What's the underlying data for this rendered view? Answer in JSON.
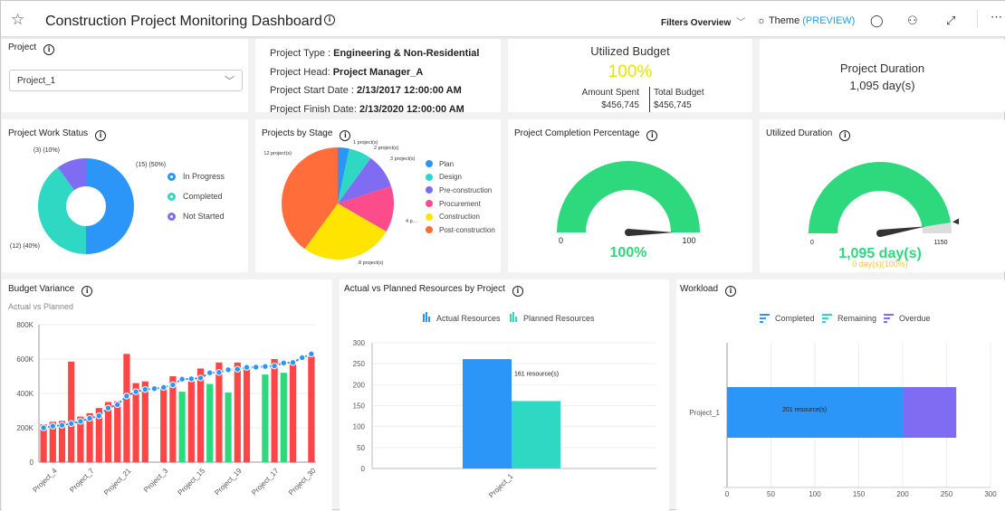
{
  "header": {
    "title": "Construction Project Monitoring Dashboard",
    "filters_label": "Filters Overview",
    "theme_label": "Theme",
    "theme_preview": "(PREVIEW)",
    "icons": [
      "star-icon",
      "info-icon",
      "chevron-down-icon",
      "sun-icon",
      "comment-icon",
      "glasses-icon",
      "expand-icon",
      "more-icon"
    ]
  },
  "project_filter": {
    "title": "Project",
    "selected": "Project_1"
  },
  "project_info": {
    "type_label": "Project Type : ",
    "type_value": "Engineering & Non-Residential",
    "head_label": "Project Head: ",
    "head_value": "Project Manager_A",
    "start_label": "Project Start Date : ",
    "start_value": "2/13/2017 12:00:00 AM",
    "finish_label": "Project Finish Date: ",
    "finish_value": "2/13/2020 12:00:00 AM"
  },
  "utilized_budget": {
    "title": "Utilized Budget",
    "percent": "100%",
    "spent_label": "Amount Spent",
    "spent_value": "$456,745",
    "total_label": "Total Budget",
    "total_value": "$456,745",
    "colors": {
      "percent": "#e5e500"
    }
  },
  "project_duration": {
    "title": "Project Duration",
    "value": "1,095 day(s)"
  },
  "chart_data": [
    {
      "id": "work-status",
      "type": "pie",
      "title": "Project Work Status",
      "donut": true,
      "categories": [
        "In Progress",
        "Completed",
        "Not Started"
      ],
      "values": [
        15,
        12,
        3
      ],
      "labels": [
        "(15) (50%)",
        "(12) (40%)",
        "(3) (10%)"
      ],
      "colors": [
        "#2b96f8",
        "#2ed8c3",
        "#7f6cf3"
      ],
      "legend": "right"
    },
    {
      "id": "projects-by-stage",
      "type": "pie",
      "title": "Projects by Stage",
      "categories": [
        "Plan",
        "Design",
        "Pre-construction",
        "Procurement",
        "Construction",
        "Post-construction"
      ],
      "values": [
        1,
        2,
        3,
        4,
        8,
        12
      ],
      "labels": [
        "1 project(s)",
        "2 project(s)",
        "3 project(s)",
        "4 p...",
        "8 project(s)",
        "12 project(s)"
      ],
      "colors": [
        "#2b96f8",
        "#2ed8c3",
        "#7f6cf3",
        "#fc4c8c",
        "#fee400",
        "#ff6d3a"
      ],
      "legend": "right"
    },
    {
      "id": "completion-gauge",
      "type": "gauge",
      "title": "Project Completion Percentage",
      "min": 0,
      "max": 100,
      "value": 100,
      "label": "100%",
      "min_label": "0",
      "max_label": "100",
      "color": "#2ed87c"
    },
    {
      "id": "utilized-duration-gauge",
      "type": "gauge",
      "title": "Utilized Duration",
      "min": 0,
      "max": 1150,
      "value": 1095,
      "label": "1,095 day(s)",
      "sublabel": "0 day(s)(100%)",
      "min_label": "0",
      "max_label": "1150",
      "color": "#2ed87c",
      "remaining_color": "#ddd"
    },
    {
      "id": "budget-variance",
      "type": "bar",
      "title": "Budget Variance",
      "subtitle": "Actual vs Planned",
      "ylim": [
        0,
        800000
      ],
      "yticks": [
        "0",
        "200K",
        "400K",
        "600K",
        "800K"
      ],
      "xtick_labels": [
        "Project_4",
        "Project_7",
        "Project_21",
        "Project_3",
        "Project_15",
        "Project_19",
        "Project_17",
        "Project_30"
      ],
      "series": [
        {
          "name": "Actual",
          "values": [
            220000,
            235000,
            240000,
            585000,
            265000,
            285000,
            315000,
            350000,
            355000,
            630000,
            460000,
            470000,
            0,
            425000,
            500000,
            410000,
            470000,
            545000,
            455000,
            580000,
            405000,
            580000,
            540000,
            0,
            510000,
            600000,
            520000,
            570000,
            0,
            615000
          ],
          "colors_by_status": [
            "over",
            "over",
            "over",
            "over",
            "over",
            "over",
            "over",
            "over",
            "over",
            "over",
            "over",
            "over",
            "none",
            "over",
            "over",
            "under",
            "over",
            "over",
            "under",
            "over",
            "under",
            "over",
            "over",
            "none",
            "under",
            "over",
            "under",
            "over",
            "none",
            "over"
          ]
        },
        {
          "name": "Planned",
          "type": "line",
          "values": [
            200000,
            210000,
            215000,
            225000,
            238000,
            255000,
            270000,
            315000,
            335000,
            385000,
            410000,
            423000,
            428000,
            435000,
            450000,
            483000,
            485000,
            490000,
            520000,
            522000,
            538000,
            541000,
            552000,
            553000,
            557000,
            560000,
            577000,
            580000,
            608000,
            630000
          ]
        }
      ],
      "colors": {
        "over": "#ff4545",
        "under": "#2ed87c",
        "line": "#2b96f8"
      }
    },
    {
      "id": "resources",
      "type": "bar",
      "title": "Actual vs Planned Resources by Project",
      "categories": [
        "Project_1"
      ],
      "ylim": [
        0,
        300
      ],
      "yticks": [
        "0",
        "50",
        "100",
        "150",
        "200",
        "250",
        "300"
      ],
      "series": [
        {
          "name": "Actual Resources",
          "values": [
            261
          ],
          "color": "#2b96f8"
        },
        {
          "name": "Planned Resources",
          "values": [
            161
          ],
          "color": "#2ed8c3",
          "data_label": "161 resource(s)"
        }
      ],
      "legend": "top"
    },
    {
      "id": "workload",
      "type": "bar",
      "orientation": "horizontal",
      "stacked": true,
      "title": "Workload",
      "categories": [
        "Project_1"
      ],
      "xlim": [
        0,
        300
      ],
      "xticks": [
        "0",
        "50",
        "100",
        "150",
        "200",
        "250",
        "300"
      ],
      "series": [
        {
          "name": "Completed",
          "values": [
            201
          ],
          "color": "#2b96f8",
          "data_label": "201 resource(s)"
        },
        {
          "name": "Remaining",
          "values": [
            0
          ],
          "color": "#2ed8c3"
        },
        {
          "name": "Overdue",
          "values": [
            60
          ],
          "color": "#7f6cf3"
        }
      ],
      "legend": "top"
    }
  ]
}
